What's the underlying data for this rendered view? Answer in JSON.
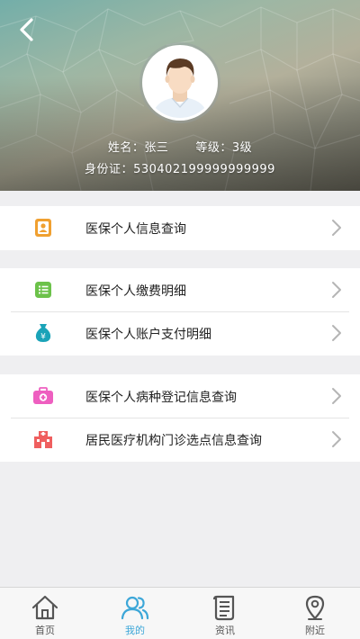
{
  "header": {
    "name_label": "姓名：",
    "name_value": "张三",
    "level_label": "等级：",
    "level_value": "3级",
    "id_label": "身份证：",
    "id_value": "530402199999999999"
  },
  "menu": {
    "group1": [
      {
        "label": "医保个人信息查询",
        "icon": "person-card-icon",
        "color": "#f0a030"
      }
    ],
    "group2": [
      {
        "label": "医保个人缴费明细",
        "icon": "list-icon",
        "color": "#6cc24a"
      },
      {
        "label": "医保个人账户支付明细",
        "icon": "money-bag-icon",
        "color": "#1aa3b8"
      }
    ],
    "group3": [
      {
        "label": "医保个人病种登记信息查询",
        "icon": "medical-kit-icon",
        "color": "#ee5fc0"
      },
      {
        "label": "居民医疗机构门诊选点信息查询",
        "icon": "hospital-icon",
        "color": "#ef5f5f"
      }
    ]
  },
  "tabbar": {
    "tabs": [
      {
        "label": "首页",
        "icon": "home-icon",
        "active": false
      },
      {
        "label": "我的",
        "icon": "users-icon",
        "active": true
      },
      {
        "label": "资讯",
        "icon": "news-icon",
        "active": false
      },
      {
        "label": "附近",
        "icon": "location-pin-icon",
        "active": false
      }
    ],
    "active_color": "#3da7d8",
    "inactive_color": "#555555"
  }
}
